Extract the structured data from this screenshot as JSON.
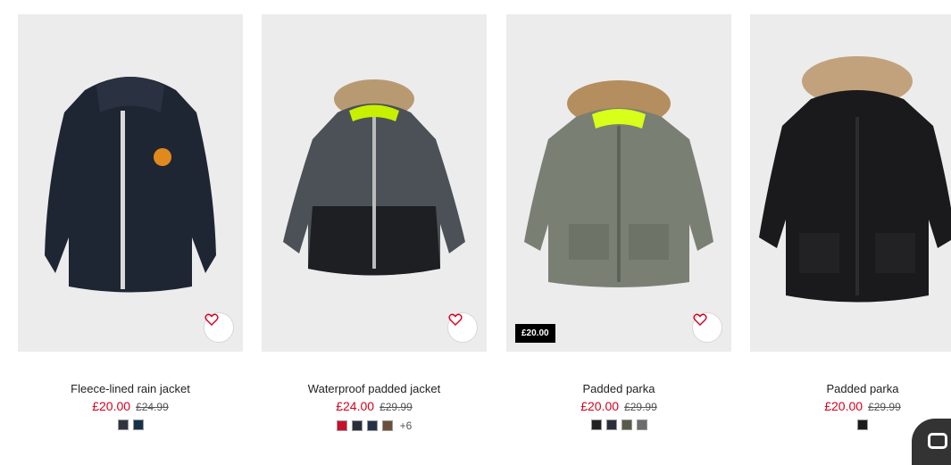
{
  "products": [
    {
      "title": "Fleece-lined rain jacket",
      "price": "£20.00",
      "old_price": "£24.99",
      "badge": "",
      "swatches": [
        "#2f3440",
        "#16324a"
      ],
      "more": ""
    },
    {
      "title": "Waterproof padded jacket",
      "price": "£24.00",
      "old_price": "£29.99",
      "badge": "",
      "swatches": [
        "#c8102e",
        "#2b2f3a",
        "#25304a",
        "#6b4f3a"
      ],
      "more": "+6"
    },
    {
      "title": "Padded parka",
      "price": "£20.00",
      "old_price": "£29.99",
      "badge": "£20.00",
      "swatches": [
        "#222222",
        "#2b2f3a",
        "#5a5a48",
        "#6d6d6d"
      ],
      "more": ""
    },
    {
      "title": "Padded parka",
      "price": "£20.00",
      "old_price": "£29.99",
      "badge": "",
      "swatches": [
        "#1b1b1b"
      ],
      "more": ""
    }
  ],
  "icons": {
    "favourite": "heart-icon",
    "chat": "chat-icon"
  }
}
